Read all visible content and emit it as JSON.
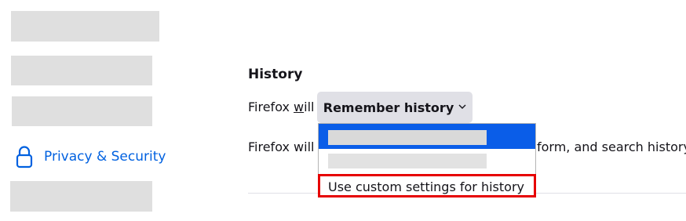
{
  "sidebar": {
    "active_item": {
      "label": "Privacy & Security",
      "icon": "lock-icon"
    }
  },
  "history": {
    "heading": "History",
    "will_label": "Firefox will",
    "will_label_underlined_letter": "w",
    "dropdown": {
      "selected_value": "Remember history",
      "options": [
        {
          "label": ""
        },
        {
          "label": ""
        },
        {
          "label": "Use custom settings for history"
        }
      ]
    },
    "description_start": "Firefox will r",
    "description_end": "form, and search history."
  },
  "colors": {
    "accent": "#0061e0",
    "selected_option": "#0a5de8",
    "highlight_border": "#e60000",
    "button_bg": "#e0e0e6"
  }
}
